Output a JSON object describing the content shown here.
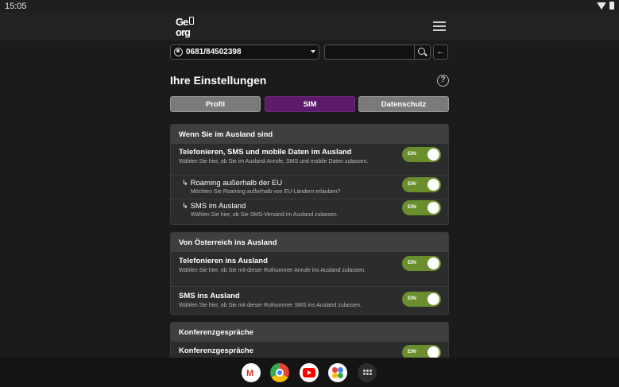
{
  "statusbar": {
    "time": "15:05"
  },
  "header": {
    "logo_line1": "Ge",
    "logo_line2": "org"
  },
  "toolbar": {
    "number": "0681/84502398",
    "search_placeholder": "",
    "back_label": "←"
  },
  "page": {
    "title": "Ihre Einstellungen",
    "help_label": "?"
  },
  "tabs": [
    {
      "label": "Profil",
      "active": false
    },
    {
      "label": "SIM",
      "active": true
    },
    {
      "label": "Datenschutz",
      "active": false
    }
  ],
  "sections": [
    {
      "header": "Wenn Sie im Ausland sind",
      "rows": [
        {
          "title": "Telefonieren, SMS und mobile Daten im Ausland",
          "desc": "Wählen Sie hier, ob Sie im Ausland Anrufe, SMS und mobile Daten zulassen.",
          "toggle": "EIN"
        },
        {
          "title": "↳ Roaming außerhalb der EU",
          "desc": "Möchten Sie Roaming außerhalb von EU-Ländern erlauben?",
          "toggle": "EIN"
        },
        {
          "title": "↳ SMS im Ausland",
          "desc": "Wählen Sie hier, ob Sie SMS-Versand im Ausland zulassen.",
          "toggle": "EIN"
        }
      ]
    },
    {
      "header": "Von Österreich ins Ausland",
      "rows": [
        {
          "title": "Telefonieren ins Ausland",
          "desc": "Wählen Sie hier, ob Sie mit dieser Rufnummer Anrufe ins Ausland zulassen.",
          "toggle": "EIN"
        },
        {
          "title": "SMS ins Ausland",
          "desc": "Wählen Sie hier, ob Sie mit dieser Rufnummer SMS ins Ausland zulassen.",
          "toggle": "EIN"
        }
      ]
    },
    {
      "header": "Konferenzgespräche",
      "rows": [
        {
          "title": "Konferenzgespräche",
          "desc": "",
          "toggle": "EIN"
        }
      ]
    }
  ],
  "colors": {
    "tab_active": "#5c1a6a",
    "toggle_on": "#6a8e2e"
  },
  "dock": [
    "gmail-icon",
    "chrome-icon",
    "youtube-icon",
    "photos-icon",
    "app-drawer-icon"
  ]
}
